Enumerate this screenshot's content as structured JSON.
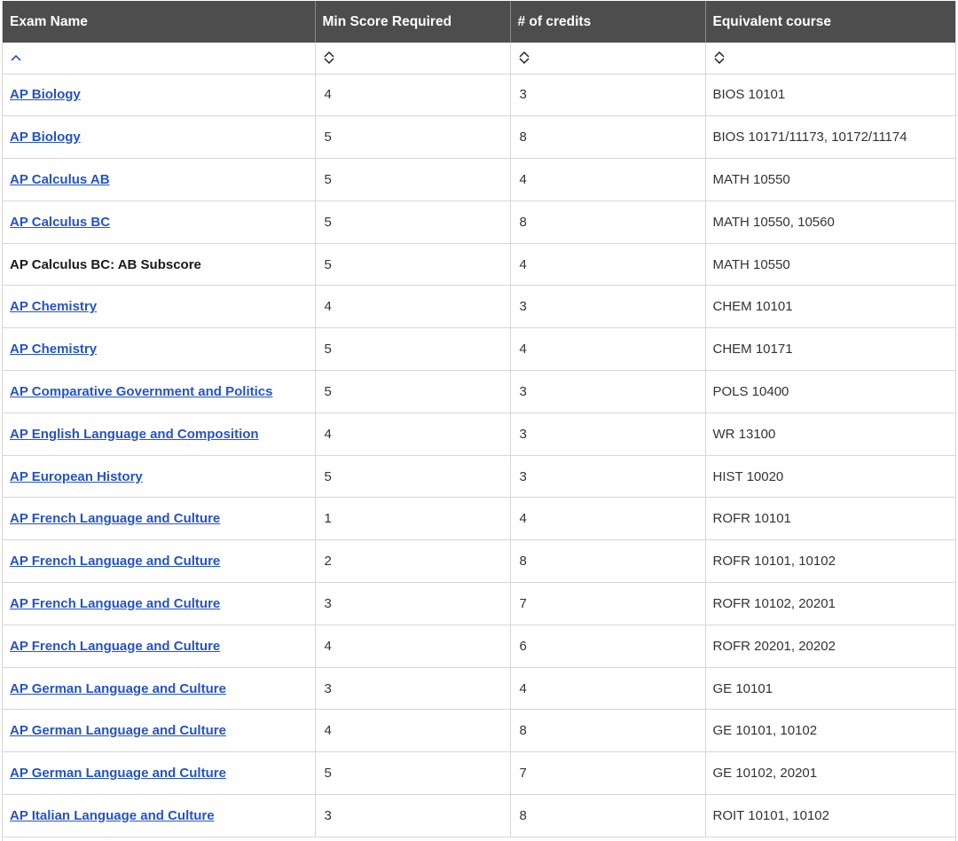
{
  "table": {
    "headers": {
      "exam_name": "Exam Name",
      "min_score": "Min Score Required",
      "credits": "# of credits",
      "equivalent": "Equivalent course"
    },
    "sort_state": {
      "exam_name": "ascending",
      "min_score": "unsorted",
      "credits": "unsorted",
      "equivalent": "unsorted"
    },
    "colors": {
      "header_bg": "#4d4d4d",
      "link": "#2553c6",
      "sort_active": "#2553c6"
    },
    "rows": [
      {
        "exam": "AP Biology",
        "link": true,
        "score": "4",
        "credits": "3",
        "course": "BIOS 10101"
      },
      {
        "exam": "AP Biology",
        "link": true,
        "score": "5",
        "credits": "8",
        "course": "BIOS 10171/11173, 10172/11174"
      },
      {
        "exam": "AP Calculus AB",
        "link": true,
        "score": "5",
        "credits": "4",
        "course": "MATH 10550"
      },
      {
        "exam": "AP Calculus BC",
        "link": true,
        "score": "5",
        "credits": "8",
        "course": "MATH 10550, 10560"
      },
      {
        "exam": "AP Calculus BC: AB Subscore",
        "link": false,
        "score": "5",
        "credits": "4",
        "course": "MATH 10550"
      },
      {
        "exam": "AP Chemistry",
        "link": true,
        "score": "4",
        "credits": "3",
        "course": "CHEM 10101"
      },
      {
        "exam": "AP Chemistry",
        "link": true,
        "score": "5",
        "credits": "4",
        "course": "CHEM 10171"
      },
      {
        "exam": "AP Comparative Government and Politics",
        "link": true,
        "score": "5",
        "credits": "3",
        "course": "POLS 10400"
      },
      {
        "exam": "AP English Language and Composition",
        "link": true,
        "score": "4",
        "credits": "3",
        "course": "WR 13100"
      },
      {
        "exam": "AP European History",
        "link": true,
        "score": "5",
        "credits": "3",
        "course": "HIST 10020"
      },
      {
        "exam": "AP French Language and Culture",
        "link": true,
        "score": "1",
        "credits": "4",
        "course": "ROFR 10101"
      },
      {
        "exam": "AP French Language and Culture",
        "link": true,
        "score": "2",
        "credits": "8",
        "course": "ROFR 10101, 10102"
      },
      {
        "exam": "AP French Language and Culture",
        "link": true,
        "score": "3",
        "credits": "7",
        "course": "ROFR 10102, 20201"
      },
      {
        "exam": "AP French Language and Culture",
        "link": true,
        "score": "4",
        "credits": "6",
        "course": "ROFR 20201, 20202"
      },
      {
        "exam": "AP German Language and Culture",
        "link": true,
        "score": "3",
        "credits": "4",
        "course": "GE 10101"
      },
      {
        "exam": "AP German Language and Culture",
        "link": true,
        "score": "4",
        "credits": "8",
        "course": "GE 10101, 10102"
      },
      {
        "exam": "AP German Language and Culture",
        "link": true,
        "score": "5",
        "credits": "7",
        "course": "GE 10102, 20201"
      },
      {
        "exam": "AP Italian Language and Culture",
        "link": true,
        "score": "3",
        "credits": "8",
        "course": "ROIT 10101, 10102"
      }
    ]
  }
}
